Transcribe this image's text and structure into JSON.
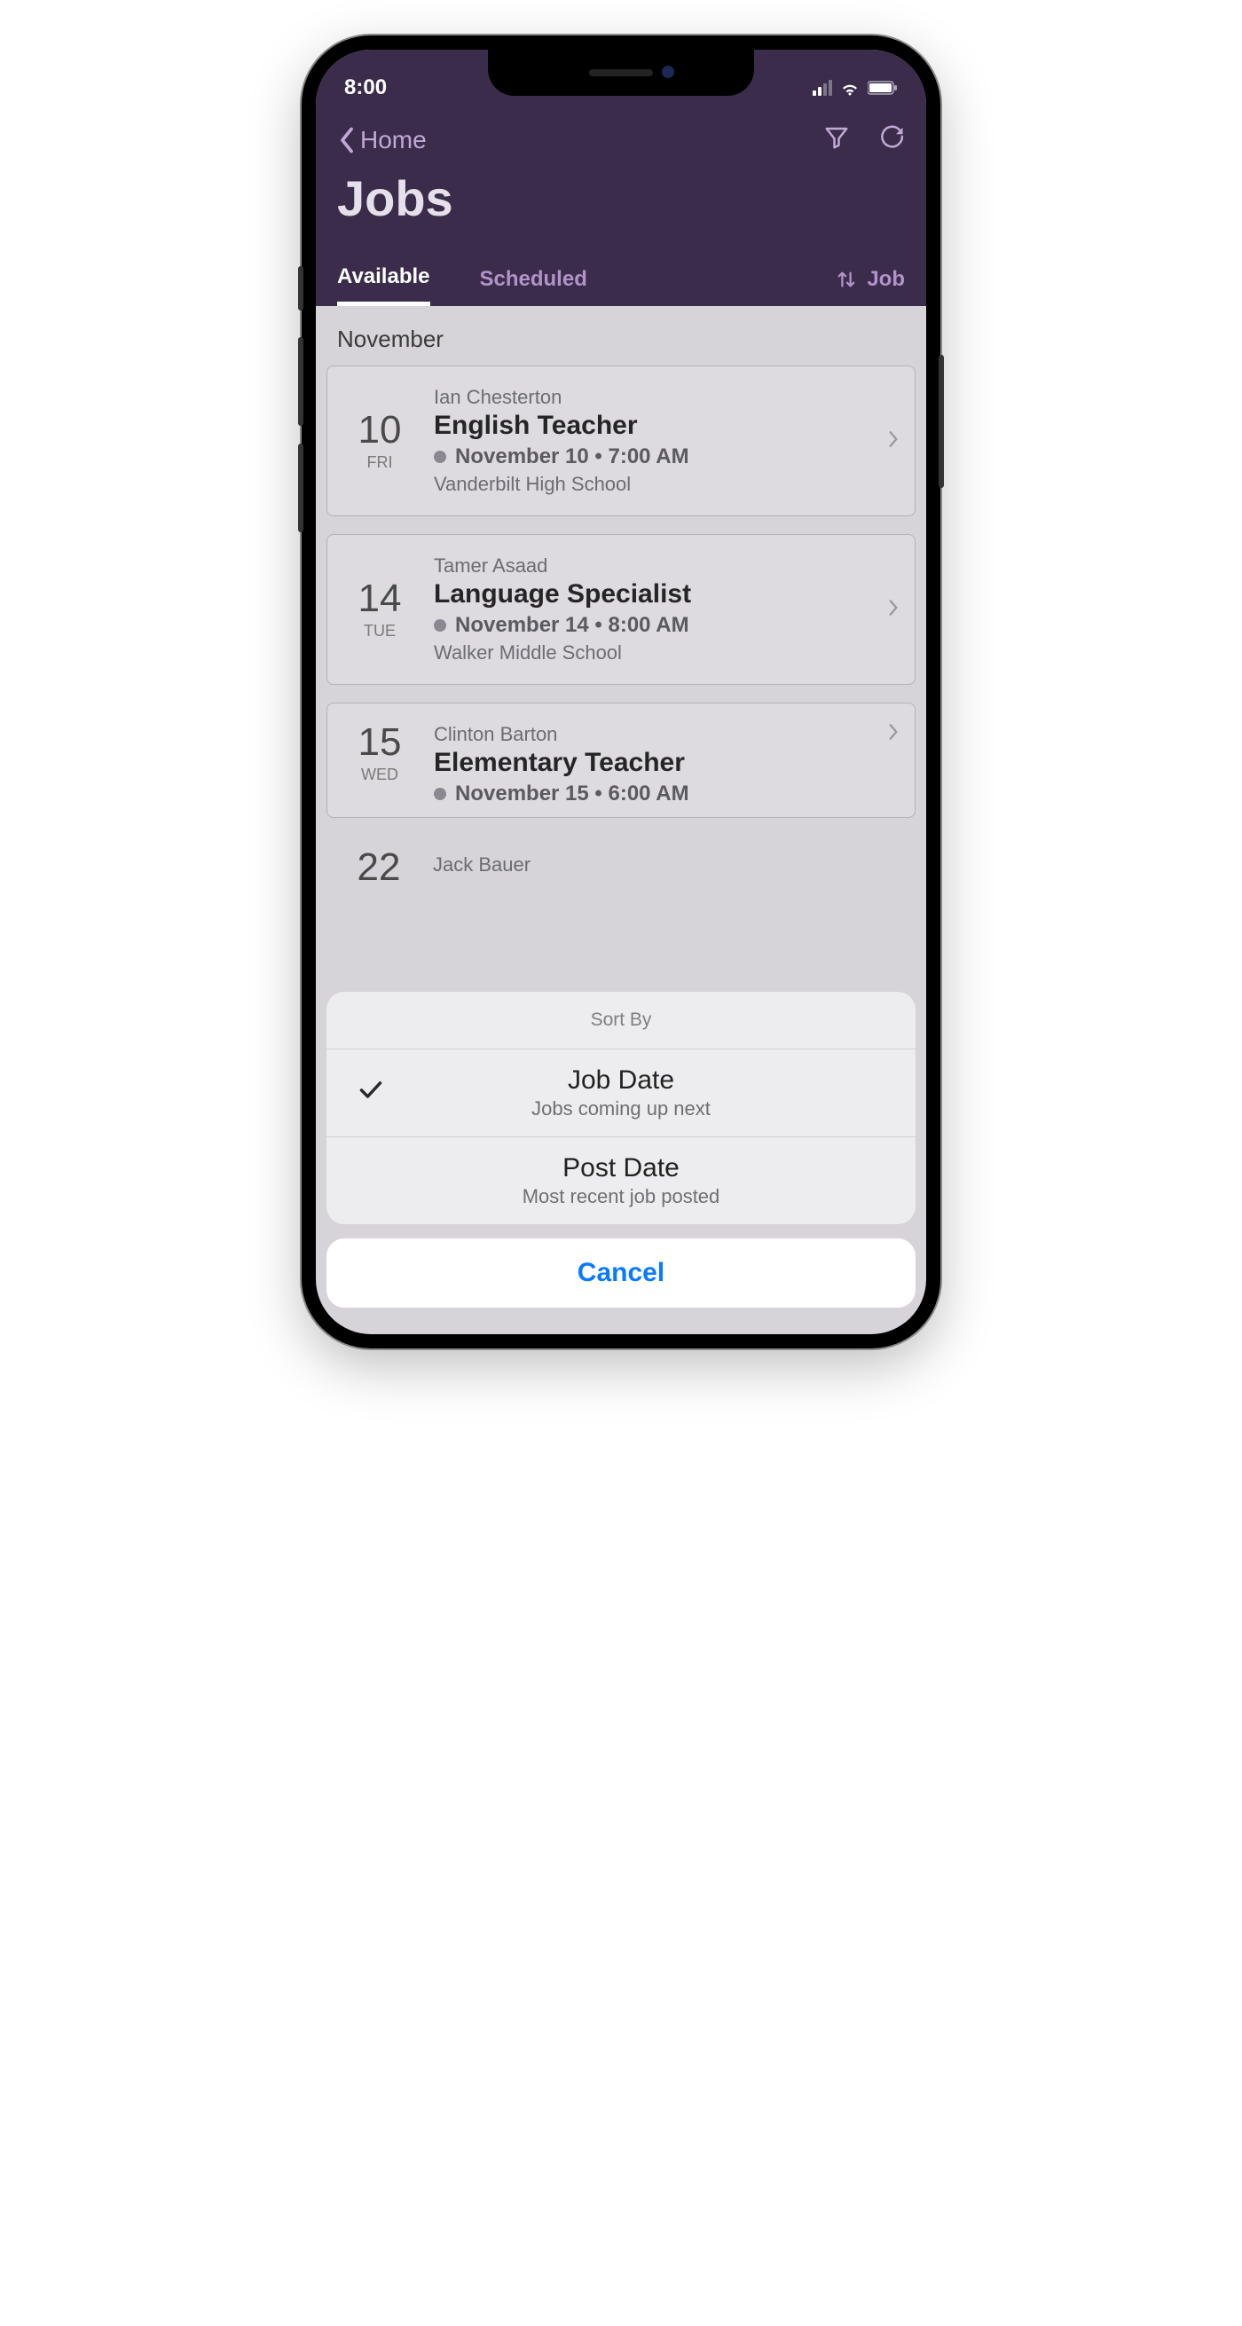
{
  "status": {
    "time": "8:00"
  },
  "nav": {
    "back_label": "Home"
  },
  "page": {
    "title": "Jobs"
  },
  "tabs": {
    "available": "Available",
    "scheduled": "Scheduled",
    "sort_label": "Job"
  },
  "month_label": "November",
  "jobs": [
    {
      "day": "10",
      "dow": "FRI",
      "person": "Ian Chesterton",
      "role": "English Teacher",
      "when": "November 10 • 7:00 AM",
      "location": "Vanderbilt High School"
    },
    {
      "day": "14",
      "dow": "TUE",
      "person": "Tamer Asaad",
      "role": "Language Specialist",
      "when": "November 14 • 8:00 AM",
      "location": "Walker Middle School"
    },
    {
      "day": "15",
      "dow": "WED",
      "person": "Clinton Barton",
      "role": "Elementary Teacher",
      "when": "November 15 • 6:00 AM",
      "location": ""
    }
  ],
  "partial": {
    "day": "22",
    "person": "Jack Bauer"
  },
  "sheet": {
    "title": "Sort By",
    "options": [
      {
        "title": "Job Date",
        "subtitle": "Jobs coming up next",
        "selected": true
      },
      {
        "title": "Post Date",
        "subtitle": "Most recent job posted",
        "selected": false
      }
    ],
    "cancel": "Cancel"
  },
  "colors": {
    "accent": "#3a2c4a",
    "link": "#0a7aff"
  }
}
